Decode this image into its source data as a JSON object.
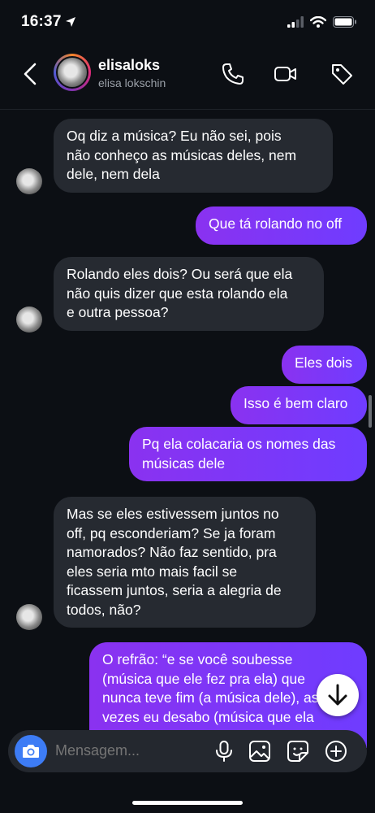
{
  "status": {
    "time": "16:37"
  },
  "header": {
    "name": "elisaloks",
    "subtitle": "elisa lokschin"
  },
  "messages": [
    {
      "side": "in",
      "text": "Oq diz a música? Eu não sei, pois\nnão conheço as músicas deles, nem\ndele, nem dela"
    },
    {
      "side": "out",
      "text": "Que tá rolando no off"
    },
    {
      "side": "in",
      "text": "Rolando eles dois? Ou será que ela\nnão quis dizer que esta rolando ela\ne outra pessoa?"
    },
    {
      "side": "out",
      "text": "Eles dois"
    },
    {
      "side": "out",
      "text": "Isso é bem claro"
    },
    {
      "side": "out",
      "text": "Pq ela colacaria os nomes das\nmúsicas dele"
    },
    {
      "side": "in",
      "text": "Mas se eles estivessem juntos no\noff, pq esconderiam? Se ja foram\nnamorados? Não faz sentido, pra\neles seria mto mais facil se\nficassem juntos, seria a alegria de\ntodos, não?"
    },
    {
      "side": "out",
      "text": "O refrão: “e se você soubesse\n(música que ele fez pra ela) que\nnunca teve fim (a música dele), as\nvezes eu desabo (música que ela"
    }
  ],
  "composer": {
    "placeholder": "Mensagem..."
  },
  "icons": {
    "back": "chevron-left-icon",
    "call": "phone-icon",
    "video": "video-camera-icon",
    "tag": "tag-icon",
    "camera": "camera-icon",
    "mic": "microphone-icon",
    "gallery": "image-icon",
    "sticker": "sticker-icon",
    "add": "plus-circle-icon",
    "scroll": "arrow-down-icon"
  },
  "colors": {
    "background": "#0c0f14",
    "incoming": "#262a31",
    "outgoing_start": "#8a32f0",
    "outgoing_end": "#6f3cff",
    "camera_button": "#3d7cf5"
  }
}
